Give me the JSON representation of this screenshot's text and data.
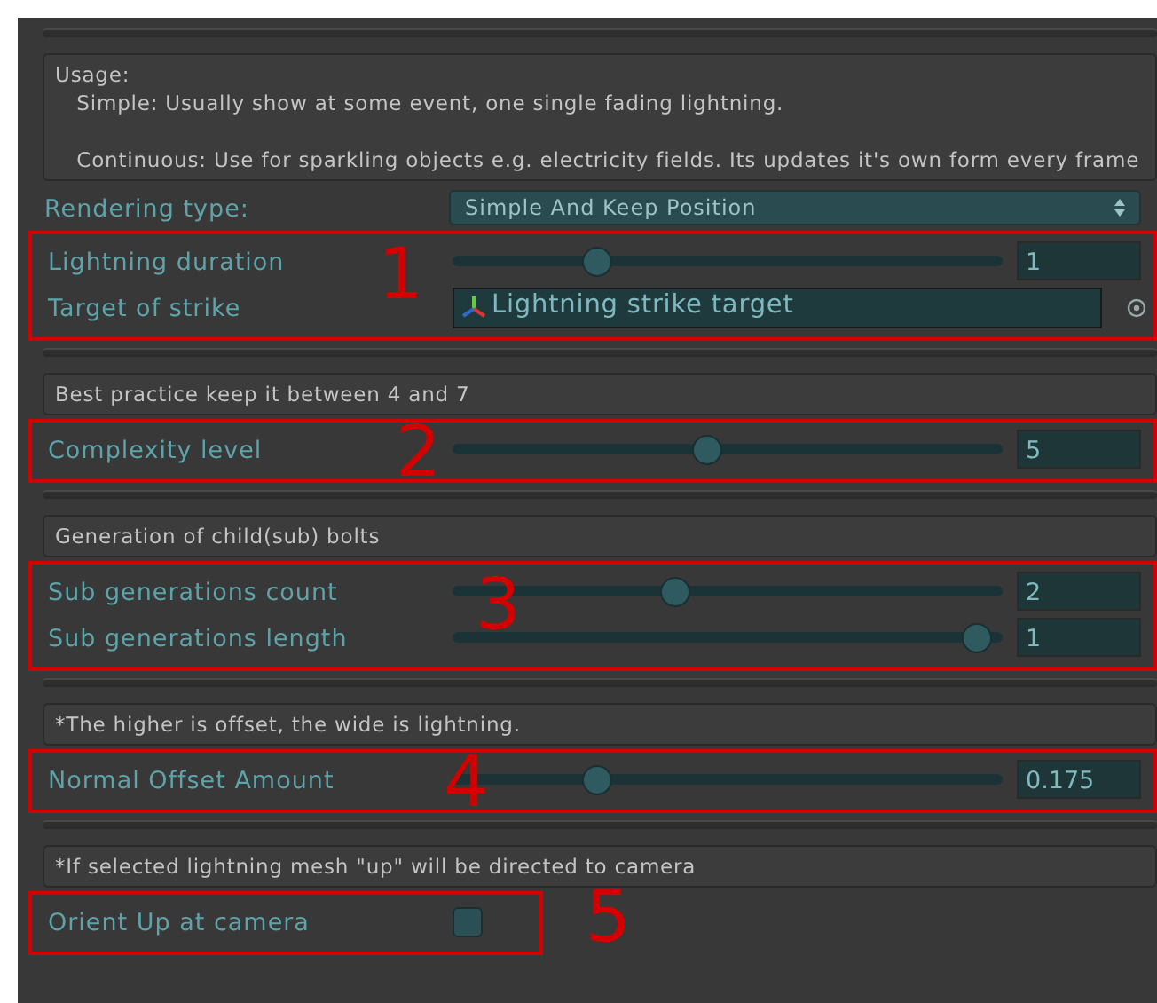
{
  "sections": [
    {
      "help": "Usage:\n   Simple: Usually show at some event, one single fading lightning.\n\n   Continuous: Use for sparkling objects e.g. electricity fields. Its updates it's own form every frame",
      "rows": [
        {
          "kind": "dropdown",
          "label": "Rendering type:",
          "value": "Simple And Keep Position"
        }
      ],
      "group": {
        "annotation": "1",
        "rows": [
          {
            "kind": "slider",
            "label": "Lightning duration",
            "level": 0.25,
            "value": "1"
          },
          {
            "kind": "object",
            "label": "Target of strike",
            "value": "Lightning strike target"
          }
        ]
      }
    },
    {
      "help": "Best practice keep it between 4 and 7",
      "group": {
        "annotation": "2",
        "rows": [
          {
            "kind": "slider",
            "label": "Complexity level",
            "level": 0.46,
            "value": "5"
          }
        ]
      }
    },
    {
      "help": "Generation of child(sub) bolts",
      "group": {
        "annotation": "3",
        "rows": [
          {
            "kind": "slider",
            "label": "Sub generations count",
            "level": 0.4,
            "value": "2"
          },
          {
            "kind": "slider",
            "label": "Sub generations length",
            "level": 0.98,
            "value": "1"
          }
        ]
      }
    },
    {
      "help": "*The higher is offset, the wide is lightning.",
      "group": {
        "annotation": "4",
        "rows": [
          {
            "kind": "slider",
            "label": "Normal Offset Amount",
            "level": 0.25,
            "value": "0.175"
          }
        ]
      }
    },
    {
      "help": "*If selected lightning mesh \"up\" will be directed to camera",
      "group": {
        "annotation": "5",
        "rows": [
          {
            "kind": "checkbox",
            "label": "Orient Up at camera",
            "checked": false
          }
        ]
      }
    }
  ]
}
